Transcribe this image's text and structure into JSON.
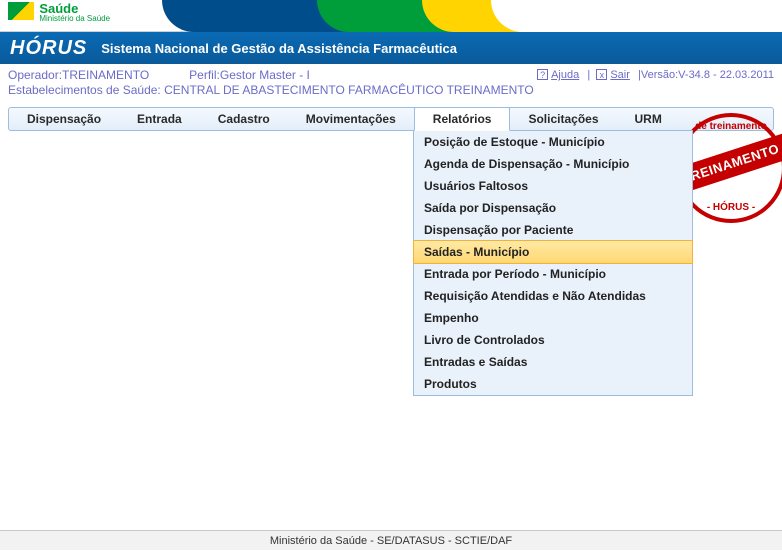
{
  "gov": {
    "line1": "Saúde",
    "line2": "Ministério da Saúde"
  },
  "system": {
    "app_name": "HÓRUS",
    "subtitle": "Sistema Nacional de Gestão da Assistência Farmacêutica"
  },
  "infobar": {
    "operador_label": "Operador:",
    "operador_value": "TREINAMENTO",
    "perfil_label": "Perfil:",
    "perfil_value": "Gestor Master - I",
    "ajuda": "Ajuda",
    "sair": "Sair",
    "versao": "|Versão:V-34.8 - 22.03.2011",
    "estab_label": "Estabelecimentos de Saúde:",
    "estab_value": "CENTRAL DE ABASTECIMENTO FARMACÊUTICO TREINAMENTO"
  },
  "menu": {
    "items": [
      "Dispensação",
      "Entrada",
      "Cadastro",
      "Movimentações",
      "Relatórios",
      "Solicitações",
      "URM"
    ],
    "active_index": 4
  },
  "dropdown": {
    "items": [
      "Posição de Estoque - Município",
      "Agenda de Dispensação - Município",
      "Usuários Faltosos",
      "Saída por Dispensação",
      "Dispensação por Paciente",
      "Saídas - Município",
      "Entrada por Período - Município",
      "Requisição Atendidas e Não Atendidas",
      "Empenho",
      "Livro de Controlados",
      "Entradas e Saídas",
      "Produtos"
    ],
    "selected_index": 5
  },
  "stamp": {
    "top": "de treinamento",
    "band": "TREINAMENTO",
    "bottom": "- HÓRUS -"
  },
  "footer": "Ministério da Saúde - SE/DATASUS - SCTIE/DAF"
}
